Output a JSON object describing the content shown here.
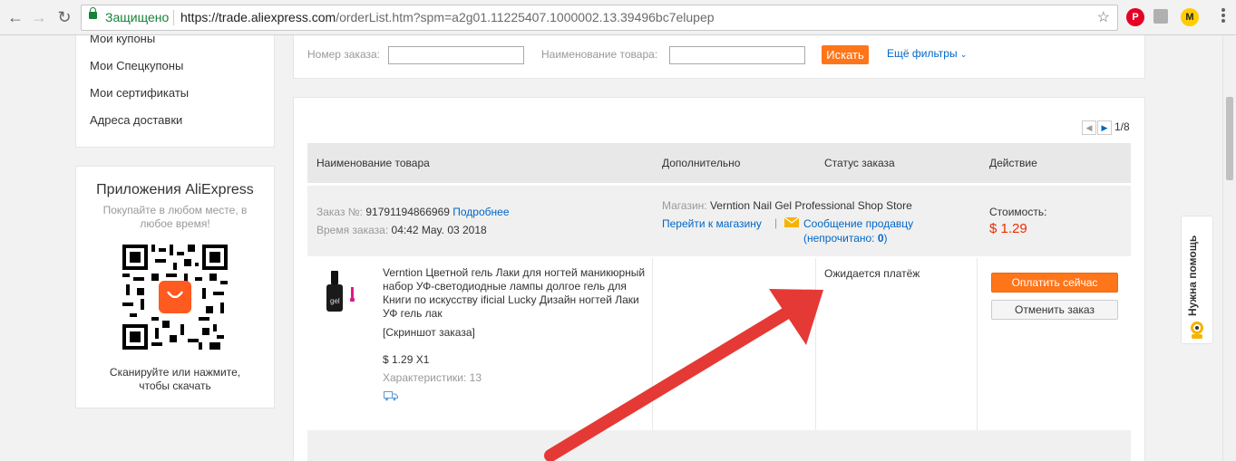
{
  "browser": {
    "secure_label": "Защищено",
    "url_host": "https://trade.aliexpress.com",
    "url_path": "/orderList.htm?spm=a2g01.11225407.1000002.13.39496bc7elupep",
    "ext_m": "M"
  },
  "sidebar": {
    "menu": [
      "Мои купоны",
      "Мои Спецкупоны",
      "Мои сертификаты",
      "Адреса доставки"
    ],
    "apps_title": "Приложения AliExpress",
    "apps_subtitle": "Покупайте в любом месте, в любое время!",
    "apps_footer": "Сканируйте или нажмите, чтобы скачать"
  },
  "filters": {
    "order_number_label": "Номер заказа:",
    "product_name_label": "Наименование товара:",
    "search_button": "Искать",
    "more_filters": "Ещё фильтры"
  },
  "pager": {
    "text": "1/8"
  },
  "table_header": {
    "product": "Наименование товара",
    "extra": "Дополнительно",
    "status": "Статус заказа",
    "action": "Действие"
  },
  "order": {
    "number_label": "Заказ №:",
    "number": "91791194866969",
    "details_link": "Подробнее",
    "time_label": "Время заказа:",
    "time": "04:42 May. 03 2018",
    "store_label": "Магазин:",
    "store_name": "Verntion Nail Gel Professional Shop Store",
    "go_to_store": "Перейти к магазину",
    "message_seller": "Сообщение продавцу",
    "unread_prefix": "(непрочитано: ",
    "unread_count": "0",
    "unread_suffix": ")",
    "cost_label": "Стоимость:",
    "cost": "$ 1.29"
  },
  "item": {
    "title": "Verntion Цветной гель Лаки для ногтей маникюрный набор УФ-светодиодные лампы долгое гель для Книги по искусству ificial Lucky Дизайн ногтей Лаки УФ гель лак",
    "screenshot_link": "[Скриншот заказа]",
    "price_qty": "$ 1.29 X1",
    "specs": "Характеристики: 13",
    "status": "Ожидается платёж",
    "pay_button": "Оплатить сейчас",
    "cancel_button": "Отменить заказ"
  },
  "help": {
    "label": "Нужна помощь"
  },
  "colors": {
    "accent": "#ff7519",
    "link": "#0067c6",
    "price": "#e62e04",
    "arrow": "#e53935"
  }
}
